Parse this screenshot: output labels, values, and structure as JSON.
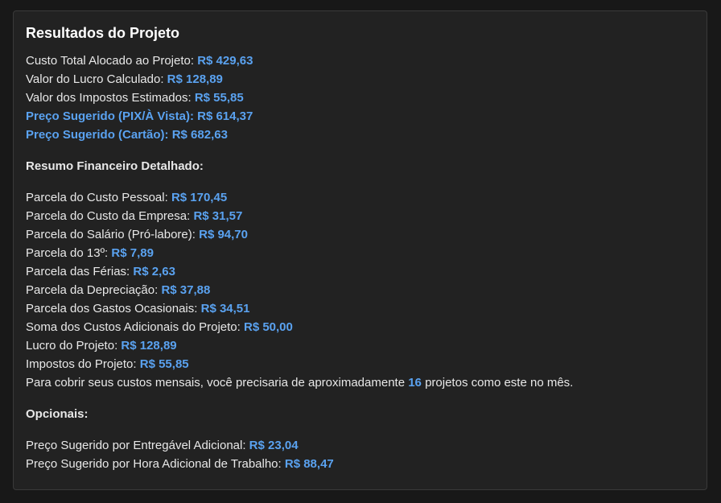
{
  "title": "Resultados do Projeto",
  "summary": [
    {
      "label": "Custo Total Alocado ao Projeto: ",
      "value": "R$ 429,63",
      "highlight": false
    },
    {
      "label": "Valor do Lucro Calculado: ",
      "value": "R$ 128,89",
      "highlight": false
    },
    {
      "label": "Valor dos Impostos Estimados: ",
      "value": "R$ 55,85",
      "highlight": false
    },
    {
      "label": "Preço Sugerido (PIX/À Vista): ",
      "value": "R$ 614,37",
      "highlight": true
    },
    {
      "label": "Preço Sugerido (Cartão): ",
      "value": "R$ 682,63",
      "highlight": true
    }
  ],
  "detail_title": "Resumo Financeiro Detalhado:",
  "details": [
    {
      "label": "Parcela do Custo Pessoal: ",
      "value": "R$ 170,45"
    },
    {
      "label": "Parcela do Custo da Empresa: ",
      "value": "R$ 31,57"
    },
    {
      "label": "Parcela do Salário (Pró-labore): ",
      "value": "R$ 94,70"
    },
    {
      "label": "Parcela do 13º: ",
      "value": "R$ 7,89"
    },
    {
      "label": "Parcela das Férias: ",
      "value": "R$ 2,63"
    },
    {
      "label": "Parcela da Depreciação: ",
      "value": "R$ 37,88"
    },
    {
      "label": "Parcela dos Gastos Ocasionais: ",
      "value": "R$ 34,51"
    },
    {
      "label": "Soma dos Custos Adicionais do Projeto: ",
      "value": "R$ 50,00"
    },
    {
      "label": "Lucro do Projeto: ",
      "value": "R$ 128,89"
    },
    {
      "label": "Impostos do Projeto: ",
      "value": "R$ 55,85"
    }
  ],
  "projects_sentence": {
    "prefix": "Para cobrir seus custos mensais, você precisaria de aproximadamente ",
    "count": "16",
    "suffix": " projetos como este no mês."
  },
  "optional_title": "Opcionais:",
  "optionals": [
    {
      "label": "Preço Sugerido por Entregável Adicional: ",
      "value": "R$ 23,04"
    },
    {
      "label": "Preço Sugerido por Hora Adicional de Trabalho: ",
      "value": "R$ 88,47"
    }
  ],
  "colors": {
    "accent": "#5aa2f0",
    "background": "#181818",
    "panel": "#222222",
    "text": "#e8e8e8"
  }
}
